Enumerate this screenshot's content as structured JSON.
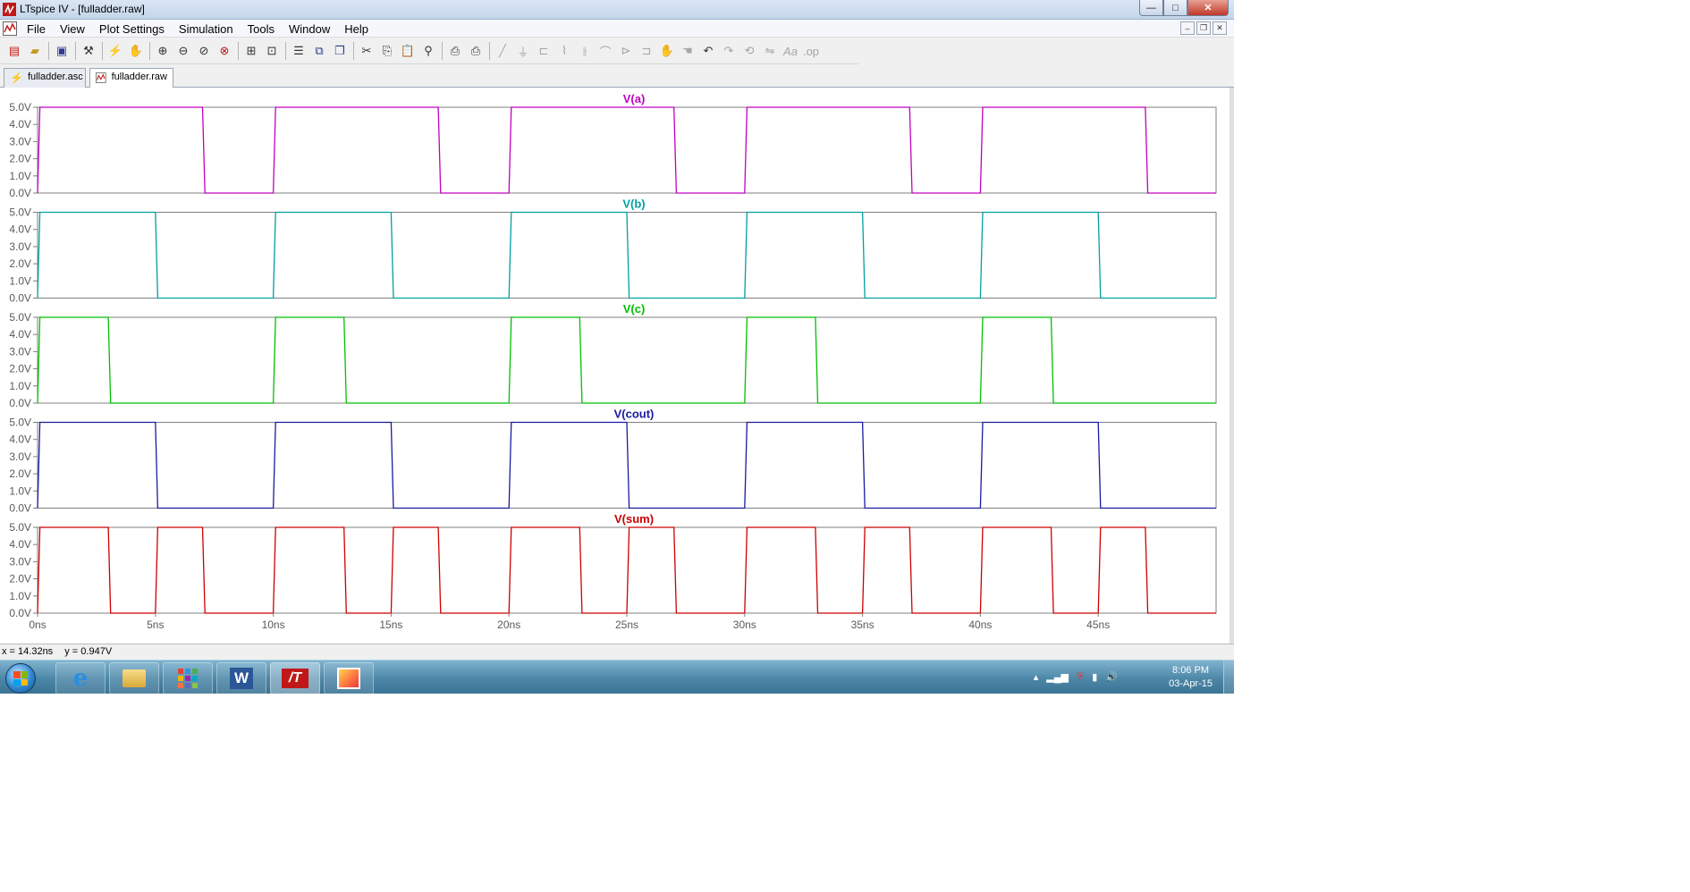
{
  "window": {
    "title": "LTspice IV - [fulladder.raw]",
    "controls": {
      "minimize": "—",
      "maximize": "□",
      "close": "✕"
    },
    "mdi_controls": {
      "minimize": "–",
      "restore": "❐",
      "close": "✕"
    }
  },
  "menu": [
    "File",
    "View",
    "Plot Settings",
    "Simulation",
    "Tools",
    "Window",
    "Help"
  ],
  "tabs": [
    {
      "label": "fulladder.asc",
      "active": false
    },
    {
      "label": "fulladder.raw",
      "active": true
    }
  ],
  "toolbar_icons": [
    "new-schematic-icon",
    "open-icon",
    "save-icon",
    "control-panel-icon",
    "run-icon",
    "halt-icon",
    "zoom-in-icon",
    "zoom-out-icon",
    "zoom-back-icon",
    "zoom-fit-icon",
    "autorange-icon",
    "mark-icon",
    "tile-horizontal-icon",
    "tile-vertical-icon",
    "cascade-icon",
    "cut-icon",
    "copy-icon",
    "paste-icon",
    "find-icon",
    "print-setup-icon",
    "print-icon",
    "wire-icon",
    "ground-icon",
    "label-icon",
    "resistor-icon",
    "capacitor-icon",
    "inductor-icon",
    "diode-icon",
    "component-icon",
    "move-icon",
    "drag-icon",
    "undo-icon",
    "redo-icon",
    "rotate-icon",
    "mirror-icon",
    "text-icon",
    "spice-directive-icon"
  ],
  "chart_data": {
    "type": "line",
    "x_unit": "ns",
    "xlim": [
      0,
      50
    ],
    "x_ticks": [
      "0ns",
      "5ns",
      "10ns",
      "15ns",
      "20ns",
      "25ns",
      "30ns",
      "35ns",
      "40ns",
      "45ns"
    ],
    "y_ticks": [
      "0.0V",
      "1.0V",
      "2.0V",
      "3.0V",
      "4.0V",
      "5.0V"
    ],
    "ylim": [
      0,
      5
    ],
    "plots": [
      {
        "name": "V(a)",
        "color": "#c000c0",
        "transitions": [
          [
            0,
            0
          ],
          [
            0.1,
            5
          ],
          [
            7.0,
            5
          ],
          [
            7.1,
            0
          ],
          [
            10.0,
            0
          ],
          [
            10.1,
            5
          ],
          [
            17.0,
            5
          ],
          [
            17.1,
            0
          ],
          [
            20.0,
            0
          ],
          [
            20.1,
            5
          ],
          [
            27.0,
            5
          ],
          [
            27.1,
            0
          ],
          [
            30.0,
            0
          ],
          [
            30.1,
            5
          ],
          [
            37.0,
            5
          ],
          [
            37.1,
            0
          ],
          [
            40.0,
            0
          ],
          [
            40.1,
            5
          ],
          [
            47.0,
            5
          ],
          [
            47.1,
            0
          ],
          [
            50,
            0
          ]
        ]
      },
      {
        "name": "V(b)",
        "color": "#00a0a0",
        "transitions": [
          [
            0,
            0
          ],
          [
            0.1,
            5
          ],
          [
            5.0,
            5
          ],
          [
            5.1,
            0
          ],
          [
            10.0,
            0
          ],
          [
            10.1,
            5
          ],
          [
            15.0,
            5
          ],
          [
            15.1,
            0
          ],
          [
            20.0,
            0
          ],
          [
            20.1,
            5
          ],
          [
            25.0,
            5
          ],
          [
            25.1,
            0
          ],
          [
            30.0,
            0
          ],
          [
            30.1,
            5
          ],
          [
            35.0,
            5
          ],
          [
            35.1,
            0
          ],
          [
            40.0,
            0
          ],
          [
            40.1,
            5
          ],
          [
            45.0,
            5
          ],
          [
            45.1,
            0
          ],
          [
            50,
            0
          ]
        ]
      },
      {
        "name": "V(c)",
        "color": "#00c000",
        "transitions": [
          [
            0,
            0
          ],
          [
            0.1,
            5
          ],
          [
            3.0,
            5
          ],
          [
            3.1,
            0
          ],
          [
            10.0,
            0
          ],
          [
            10.1,
            5
          ],
          [
            13.0,
            5
          ],
          [
            13.1,
            0
          ],
          [
            20.0,
            0
          ],
          [
            20.1,
            5
          ],
          [
            23.0,
            5
          ],
          [
            23.1,
            0
          ],
          [
            30.0,
            0
          ],
          [
            30.1,
            5
          ],
          [
            33.0,
            5
          ],
          [
            33.1,
            0
          ],
          [
            40.0,
            0
          ],
          [
            40.1,
            5
          ],
          [
            43.0,
            5
          ],
          [
            43.1,
            0
          ],
          [
            50,
            0
          ]
        ]
      },
      {
        "name": "V(cout)",
        "color": "#1a1aa0",
        "transitions": [
          [
            0,
            0
          ],
          [
            0.1,
            5
          ],
          [
            5.0,
            5
          ],
          [
            5.1,
            0
          ],
          [
            10.0,
            0
          ],
          [
            10.1,
            5
          ],
          [
            15.0,
            5
          ],
          [
            15.1,
            0
          ],
          [
            20.0,
            0
          ],
          [
            20.1,
            5
          ],
          [
            25.0,
            5
          ],
          [
            25.1,
            0
          ],
          [
            30.0,
            0
          ],
          [
            30.1,
            5
          ],
          [
            35.0,
            5
          ],
          [
            35.1,
            0
          ],
          [
            40.0,
            0
          ],
          [
            40.1,
            5
          ],
          [
            45.0,
            5
          ],
          [
            45.1,
            0
          ],
          [
            50,
            0
          ]
        ]
      },
      {
        "name": "V(sum)",
        "color": "#cc0000",
        "transitions": [
          [
            0,
            0
          ],
          [
            0.1,
            5
          ],
          [
            3.0,
            5
          ],
          [
            3.1,
            0
          ],
          [
            5.0,
            0
          ],
          [
            5.1,
            5
          ],
          [
            7.0,
            5
          ],
          [
            7.1,
            0
          ],
          [
            10.0,
            0
          ],
          [
            10.1,
            5
          ],
          [
            13.0,
            5
          ],
          [
            13.1,
            0
          ],
          [
            15.0,
            0
          ],
          [
            15.1,
            5
          ],
          [
            17.0,
            5
          ],
          [
            17.1,
            0
          ],
          [
            20.0,
            0
          ],
          [
            20.1,
            5
          ],
          [
            23.0,
            5
          ],
          [
            23.1,
            0
          ],
          [
            25.0,
            0
          ],
          [
            25.1,
            5
          ],
          [
            27.0,
            5
          ],
          [
            27.1,
            0
          ],
          [
            30.0,
            0
          ],
          [
            30.1,
            5
          ],
          [
            33.0,
            5
          ],
          [
            33.1,
            0
          ],
          [
            35.0,
            0
          ],
          [
            35.1,
            5
          ],
          [
            37.0,
            5
          ],
          [
            37.1,
            0
          ],
          [
            40.0,
            0
          ],
          [
            40.1,
            5
          ],
          [
            43.0,
            5
          ],
          [
            43.1,
            0
          ],
          [
            45.0,
            0
          ],
          [
            45.1,
            5
          ],
          [
            47.0,
            5
          ],
          [
            47.1,
            0
          ],
          [
            50,
            0
          ]
        ]
      }
    ]
  },
  "status": {
    "x": "x = 14.32ns",
    "y": "y = 0.947V"
  },
  "taskbar": {
    "apps": [
      "explorer-icon",
      "internet-explorer-icon",
      "folder-icon",
      "start-screen-icon",
      "word-icon",
      "ltspice-icon",
      "paint-icon"
    ],
    "tray_icons": [
      "up-arrow-icon",
      "network-icon",
      "security-icon",
      "battery-icon",
      "volume-icon"
    ],
    "time": "8:06 PM",
    "date": "03-Apr-15"
  }
}
